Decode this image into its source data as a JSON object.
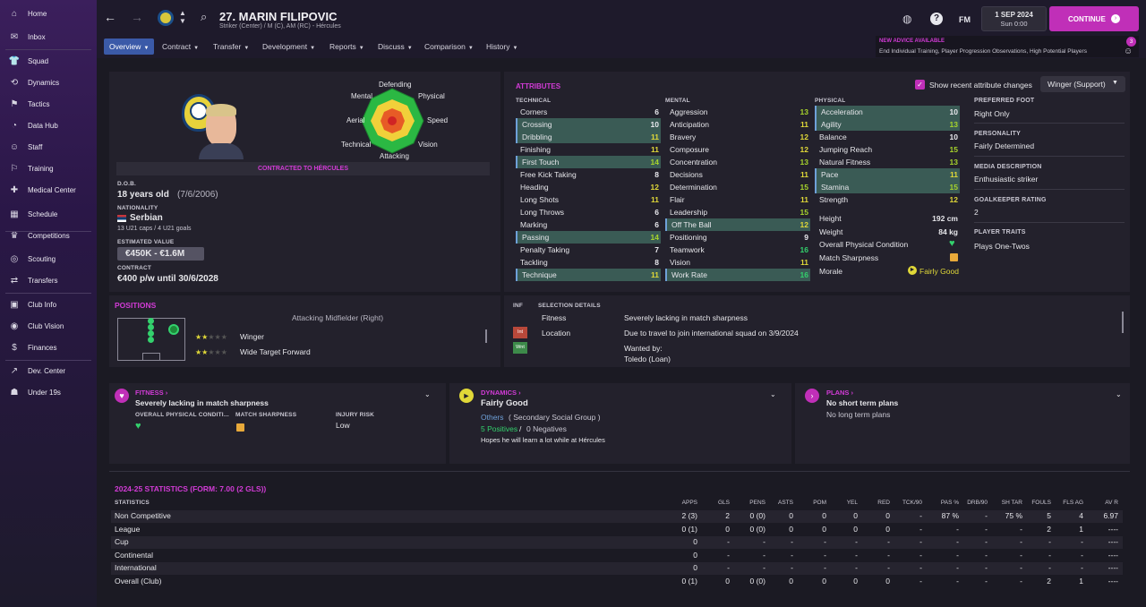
{
  "sidebar": {
    "items": [
      {
        "label": "Home",
        "icon": "home-icon",
        "glyph": "⌂"
      },
      {
        "label": "Inbox",
        "icon": "inbox-icon",
        "glyph": "✉"
      },
      {
        "label": "Squad",
        "icon": "shirt-icon",
        "glyph": "👕"
      },
      {
        "label": "Dynamics",
        "icon": "dynamics-icon",
        "glyph": "⟲"
      },
      {
        "label": "Tactics",
        "icon": "tactics-icon",
        "glyph": "⚑"
      },
      {
        "label": "Data Hub",
        "icon": "datahub-icon",
        "glyph": "◔"
      },
      {
        "label": "Staff",
        "icon": "staff-icon",
        "glyph": "☺"
      },
      {
        "label": "Training",
        "icon": "training-icon",
        "glyph": "⚐"
      },
      {
        "label": "Medical Center",
        "icon": "medical-icon",
        "glyph": "✚"
      },
      {
        "label": "Schedule",
        "icon": "schedule-icon",
        "glyph": "▦"
      },
      {
        "label": "Competitions",
        "icon": "trophy-icon",
        "glyph": "♛"
      },
      {
        "label": "Scouting",
        "icon": "scouting-icon",
        "glyph": "◎"
      },
      {
        "label": "Transfers",
        "icon": "transfers-icon",
        "glyph": "⇄"
      },
      {
        "label": "Club Info",
        "icon": "clubinfo-icon",
        "glyph": "▣"
      },
      {
        "label": "Club Vision",
        "icon": "clubvision-icon",
        "glyph": "◉"
      },
      {
        "label": "Finances",
        "icon": "finances-icon",
        "glyph": "$"
      },
      {
        "label": "Dev. Center",
        "icon": "devcenter-icon",
        "glyph": "↗"
      },
      {
        "label": "Under 19s",
        "icon": "under19-icon",
        "glyph": "☗"
      }
    ]
  },
  "header": {
    "title": "27. MARIN FILIPOVIC",
    "subtitle": "Striker (Center) / M (C), AM (RC) - Hércules",
    "date": "1 SEP 2024",
    "time": "Sun 0:00",
    "continue_label": "CONTINUE",
    "fm_label": "FM",
    "advice_title": "NEW ADVICE AVAILABLE",
    "advice_text": "End Individual Training, Player Progression Observations, High Potential Players",
    "advice_count": "3"
  },
  "tabs": [
    "Overview",
    "Contract",
    "Transfer",
    "Development",
    "Reports",
    "Discuss",
    "Comparison",
    "History"
  ],
  "profile": {
    "contract_banner": "CONTRACTED TO HÉRCULES",
    "dob_label": "D.O.B.",
    "age": "18 years old",
    "dob": "(7/6/2006)",
    "nationality_label": "NATIONALITY",
    "nationality": "Serbian",
    "caps": "13 U21 caps / 4 U21 goals",
    "value_label": "ESTIMATED VALUE",
    "value": "€450K - €1.6M",
    "contract_label": "CONTRACT",
    "contract": "€400 p/w until 30/6/2028"
  },
  "radar": {
    "labels": [
      "Defending",
      "Physical",
      "Speed",
      "Vision",
      "Attacking",
      "Technical",
      "Aerial",
      "Mental"
    ]
  },
  "attributes": {
    "title": "ATTRIBUTES",
    "show_changes": "Show recent attribute changes",
    "role": "Winger (Support)",
    "technical_label": "TECHNICAL",
    "mental_label": "MENTAL",
    "physical_label": "PHYSICAL",
    "technical": [
      [
        "Corners",
        "6"
      ],
      [
        "Crossing",
        "10"
      ],
      [
        "Dribbling",
        "11"
      ],
      [
        "Finishing",
        "11"
      ],
      [
        "First Touch",
        "14"
      ],
      [
        "Free Kick Taking",
        "8"
      ],
      [
        "Heading",
        "12"
      ],
      [
        "Long Shots",
        "11"
      ],
      [
        "Long Throws",
        "6"
      ],
      [
        "Marking",
        "6"
      ],
      [
        "Passing",
        "14"
      ],
      [
        "Penalty Taking",
        "7"
      ],
      [
        "Tackling",
        "8"
      ],
      [
        "Technique",
        "11"
      ]
    ],
    "mental": [
      [
        "Aggression",
        "13"
      ],
      [
        "Anticipation",
        "11"
      ],
      [
        "Bravery",
        "12"
      ],
      [
        "Composure",
        "12"
      ],
      [
        "Concentration",
        "13"
      ],
      [
        "Decisions",
        "11"
      ],
      [
        "Determination",
        "15"
      ],
      [
        "Flair",
        "11"
      ],
      [
        "Leadership",
        "15"
      ],
      [
        "Off The Ball",
        "12"
      ],
      [
        "Positioning",
        "9"
      ],
      [
        "Teamwork",
        "16"
      ],
      [
        "Vision",
        "11"
      ],
      [
        "Work Rate",
        "16"
      ]
    ],
    "physical": [
      [
        "Acceleration",
        "10"
      ],
      [
        "Agility",
        "13"
      ],
      [
        "Balance",
        "10"
      ],
      [
        "Jumping Reach",
        "15"
      ],
      [
        "Natural Fitness",
        "13"
      ],
      [
        "Pace",
        "11"
      ],
      [
        "Stamina",
        "15"
      ],
      [
        "Strength",
        "12"
      ]
    ],
    "height_label": "Height",
    "height": "192 cm",
    "weight_label": "Weight",
    "weight": "84 kg",
    "opc_label": "Overall Physical Condition",
    "sharpness_label": "Match Sharpness",
    "morale_label": "Morale",
    "morale": "Fairly Good"
  },
  "info": {
    "pref_foot_label": "PREFERRED FOOT",
    "pref_foot": "Right Only",
    "personality_label": "PERSONALITY",
    "personality": "Fairly Determined",
    "media_label": "MEDIA DESCRIPTION",
    "media": "Enthusiastic striker",
    "gk_label": "GOALKEEPER RATING",
    "gk": "2",
    "traits_label": "PLAYER TRAITS",
    "traits": "Plays One-Twos"
  },
  "positions": {
    "title": "POSITIONS",
    "main": "Attacking Midfielder (Right)",
    "roles": [
      "Winger",
      "Wide Target Forward"
    ]
  },
  "selection": {
    "inf_label": "INF",
    "title": "SELECTION DETAILS",
    "rows": [
      [
        "",
        "Fitness",
        "Severely lacking in match sharpness"
      ],
      [
        "Int",
        "Location",
        "Due to travel to join international squad on 3/9/2024"
      ],
      [
        "Wnt",
        "",
        "Wanted by:"
      ]
    ],
    "wanted_by": "Toledo (Loan)"
  },
  "fitness": {
    "title": "FITNESS ›",
    "status": "Severely lacking in match sharpness",
    "opc_label": "OVERALL PHYSICAL CONDITI...",
    "sharp_label": "MATCH SHARPNESS",
    "injury_label": "INJURY RISK",
    "injury": "Low"
  },
  "dynamics": {
    "title": "DYNAMICS ›",
    "status": "Fairly Good",
    "group": "Others",
    "group_desc": "( Secondary Social Group )",
    "positives": "5 Positives",
    "negatives": "0 Negatives",
    "note": "Hopes he will learn a lot while at Hércules"
  },
  "plans": {
    "title": "PLANS ›",
    "line1": "No short term plans",
    "line2": "No long term plans"
  },
  "stats": {
    "title": "2024-25 STATISTICS (FORM: 7.00 (2 GLS))",
    "label": "STATISTICS",
    "headers": [
      "APPS",
      "GLS",
      "PENS",
      "ASTS",
      "POM",
      "YEL",
      "RED",
      "TCK/90",
      "PAS %",
      "DRB/90",
      "SH TAR",
      "FOULS",
      "FLS AG",
      "AV R"
    ],
    "rows": [
      [
        "Non Competitive",
        "2 (3)",
        "2",
        "0 (0)",
        "0",
        "0",
        "0",
        "0",
        "-",
        "87 %",
        "-",
        "75 %",
        "5",
        "4",
        "6.97"
      ],
      [
        "League",
        "0 (1)",
        "0",
        "0 (0)",
        "0",
        "0",
        "0",
        "0",
        "-",
        "-",
        "-",
        "-",
        "2",
        "1",
        "----"
      ],
      [
        "Cup",
        "0",
        "-",
        "-",
        "-",
        "-",
        "-",
        "-",
        "-",
        "-",
        "-",
        "-",
        "-",
        "-",
        "----"
      ],
      [
        "Continental",
        "0",
        "-",
        "-",
        "-",
        "-",
        "-",
        "-",
        "-",
        "-",
        "-",
        "-",
        "-",
        "-",
        "----"
      ],
      [
        "International",
        "0",
        "-",
        "-",
        "-",
        "-",
        "-",
        "-",
        "-",
        "-",
        "-",
        "-",
        "-",
        "-",
        "----"
      ],
      [
        "Overall (Club)",
        "0 (1)",
        "0",
        "0 (0)",
        "0",
        "0",
        "0",
        "0",
        "-",
        "-",
        "-",
        "-",
        "2",
        "1",
        "----"
      ]
    ]
  },
  "colors": {
    "accent": "#d23bd6",
    "continue": "#c02fb8",
    "green": "#33d16d",
    "yellow": "#e0d838"
  }
}
